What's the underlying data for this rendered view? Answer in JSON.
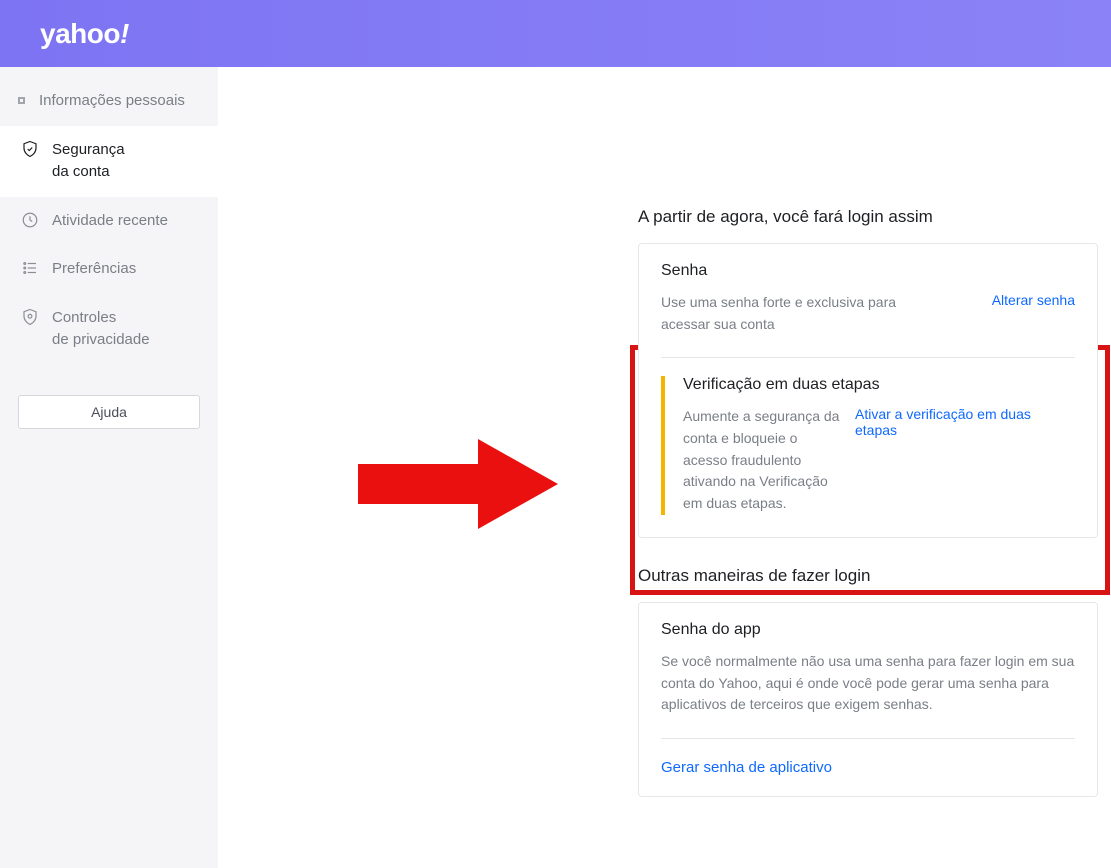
{
  "logo_text": "yahoo",
  "logo_bang": "!",
  "sidebar": {
    "items": [
      {
        "label": "Informações pessoais"
      },
      {
        "label": "Segurança\nda conta"
      },
      {
        "label": "Atividade recente"
      },
      {
        "label": "Preferências"
      },
      {
        "label": "Controles\nde privacidade"
      }
    ],
    "help_label": "Ajuda"
  },
  "main": {
    "login_heading": "A partir de agora, você fará login assim",
    "password": {
      "title": "Senha",
      "desc": "Use uma senha forte e exclusiva para acessar sua conta",
      "link": "Alterar senha"
    },
    "two_step": {
      "title": "Verificação em duas etapas",
      "desc": "Aumente a segurança da conta e bloqueie o acesso fraudulento ativando na Verificação em duas etapas.",
      "link": "Ativar a verificação em duas etapas"
    },
    "other_heading": "Outras maneiras de fazer login",
    "app_password": {
      "title": "Senha do app",
      "desc": "Se você normalmente não usa uma senha para fazer login em sua conta do Yahoo, aqui é onde você pode gerar uma senha para aplicativos de terceiros que exigem senhas.",
      "link": "Gerar senha de aplicativo"
    }
  }
}
